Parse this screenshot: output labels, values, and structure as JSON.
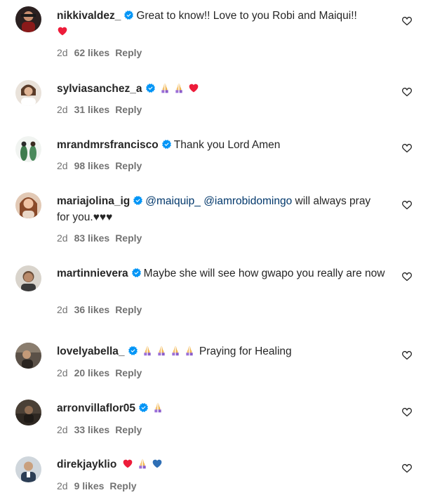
{
  "comments": [
    {
      "username": "nikkivaldez_",
      "text_before": "Great to know!! Love to you Robi and Maiqui!!",
      "time": "2d",
      "likes": "62 likes",
      "reply": "Reply",
      "avatar_color": "#3a2a2a",
      "emoji": [
        "red-heart"
      ]
    },
    {
      "username": "sylviasanchez_a",
      "time": "2d",
      "likes": "31 likes",
      "reply": "Reply",
      "avatar_color": "#c9b9a6",
      "emoji": [
        "praying-hands",
        "praying-hands",
        "red-heart"
      ]
    },
    {
      "username": "mrandmrsfrancisco",
      "text": "Thank you Lord Amen",
      "time": "2d",
      "likes": "98 likes",
      "reply": "Reply",
      "avatar_color": "#9fb7a5"
    },
    {
      "username": "mariajolina_ig",
      "mention1": "@maiquip_",
      "mention2": "@iamrobidomingo",
      "text": "will always pray for you.♥♥♥",
      "time": "2d",
      "likes": "83 likes",
      "reply": "Reply",
      "avatar_color": "#d38b5d"
    },
    {
      "username": "martinnievera",
      "text": "Maybe she will see how gwapo you really are now",
      "time": "2d",
      "likes": "36 likes",
      "reply": "Reply",
      "avatar_color": "#7a6a5a"
    },
    {
      "username": "lovelyabella_",
      "text": "Praying for Healing",
      "time": "2d",
      "likes": "20 likes",
      "reply": "Reply",
      "avatar_color": "#4a4038",
      "emoji": [
        "praying-hands",
        "praying-hands",
        "praying-hands",
        "praying-hands"
      ]
    },
    {
      "username": "arronvillaflor05",
      "time": "2d",
      "likes": "33 likes",
      "reply": "Reply",
      "avatar_color": "#3d352c",
      "emoji": [
        "praying-hands"
      ]
    },
    {
      "username": "direkjayklio",
      "time": "2d",
      "likes": "9 likes",
      "reply": "Reply",
      "avatar_color": "#5a6a7a",
      "emoji": [
        "red-heart",
        "praying-hands",
        "blue-heart"
      ]
    }
  ],
  "colors": {
    "text": "#262626",
    "meta": "#737373",
    "mention": "#00376b",
    "verified": "#0095f6",
    "heart_red": "#ed1c3a",
    "heart_blue": "#2f6fb5"
  }
}
